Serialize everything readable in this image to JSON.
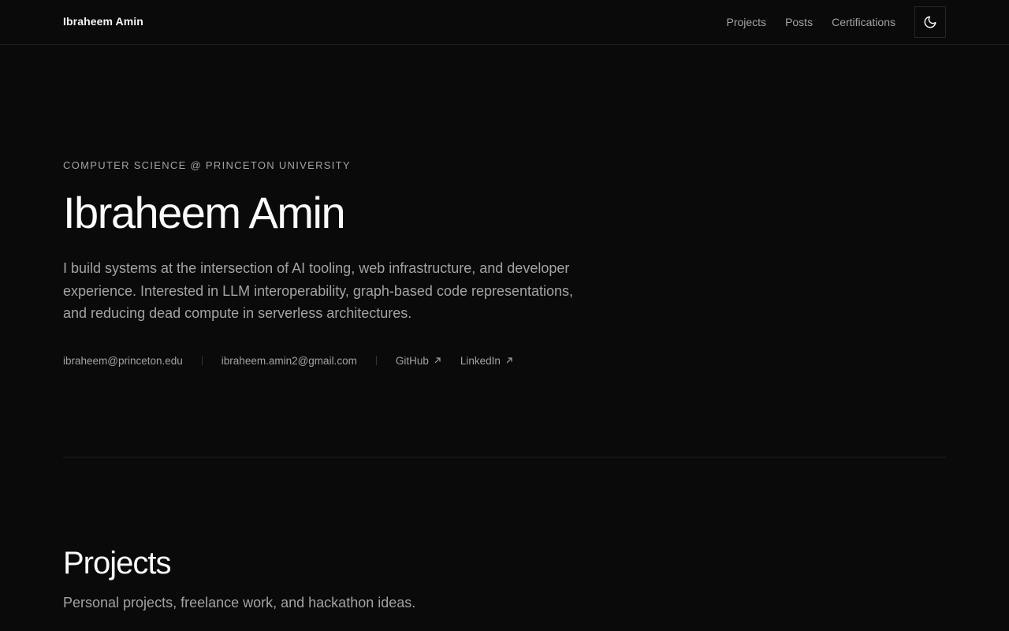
{
  "header": {
    "brand": "Ibraheem Amin",
    "nav": [
      {
        "label": "Projects"
      },
      {
        "label": "Posts"
      },
      {
        "label": "Certifications"
      }
    ],
    "theme_toggle_icon": "moon-icon"
  },
  "hero": {
    "eyebrow": "Computer Science @ Princeton University",
    "title": "Ibraheem Amin",
    "description": "I build systems at the intersection of AI tooling, web infrastructure, and developer experience. Interested in LLM interoperability, graph-based code representations, and reducing dead compute in serverless architectures.",
    "contacts": {
      "email_primary": "ibraheem@princeton.edu",
      "email_secondary": "ibraheem.amin2@gmail.com",
      "github": "GitHub",
      "linkedin": "LinkedIn",
      "external_icon": "arrow-up-right-icon"
    }
  },
  "projects": {
    "title": "Projects",
    "subtitle": "Personal projects, freelance work, and hackathon ideas."
  },
  "colors": {
    "background": "#0a0a0a",
    "text_primary": "#fafafa",
    "text_muted": "#a3a3a3",
    "border": "#1f1f1f"
  }
}
